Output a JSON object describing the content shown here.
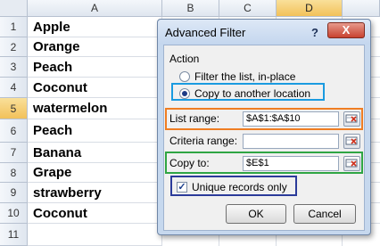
{
  "spreadsheet": {
    "columns": [
      "A",
      "B",
      "C",
      "D"
    ],
    "selected_column": "D",
    "rows": [
      {
        "num": "1",
        "value": "Apple"
      },
      {
        "num": "2",
        "value": "Orange"
      },
      {
        "num": "3",
        "value": "Peach"
      },
      {
        "num": "4",
        "value": "Coconut"
      },
      {
        "num": "5",
        "value": "watermelon"
      },
      {
        "num": "6",
        "value": "Peach"
      },
      {
        "num": "7",
        "value": "Banana"
      },
      {
        "num": "8",
        "value": "Grape"
      },
      {
        "num": "9",
        "value": "strawberry"
      },
      {
        "num": "10",
        "value": "Coconut"
      },
      {
        "num": "11",
        "value": ""
      }
    ],
    "selected_row": "5"
  },
  "dialog": {
    "title": "Advanced Filter",
    "help_label": "?",
    "close_label": "X",
    "action_group_label": "Action",
    "radio_filter_label": "Filter the list, in-place",
    "radio_copy_label": "Copy to another location",
    "selected_action": "copy",
    "list_range_label": "List range:",
    "list_range_value": "$A$1:$A$10",
    "criteria_range_label": "Criteria range:",
    "criteria_range_value": "",
    "copy_to_label": "Copy to:",
    "copy_to_value": "$E$1",
    "unique_label": "Unique records only",
    "unique_checked": true,
    "ok_label": "OK",
    "cancel_label": "Cancel"
  },
  "colors": {
    "highlight_blue": "#1a9be0",
    "highlight_orange": "#ef7d22",
    "highlight_green": "#2fa544",
    "highlight_navy": "#2b3b9a"
  }
}
